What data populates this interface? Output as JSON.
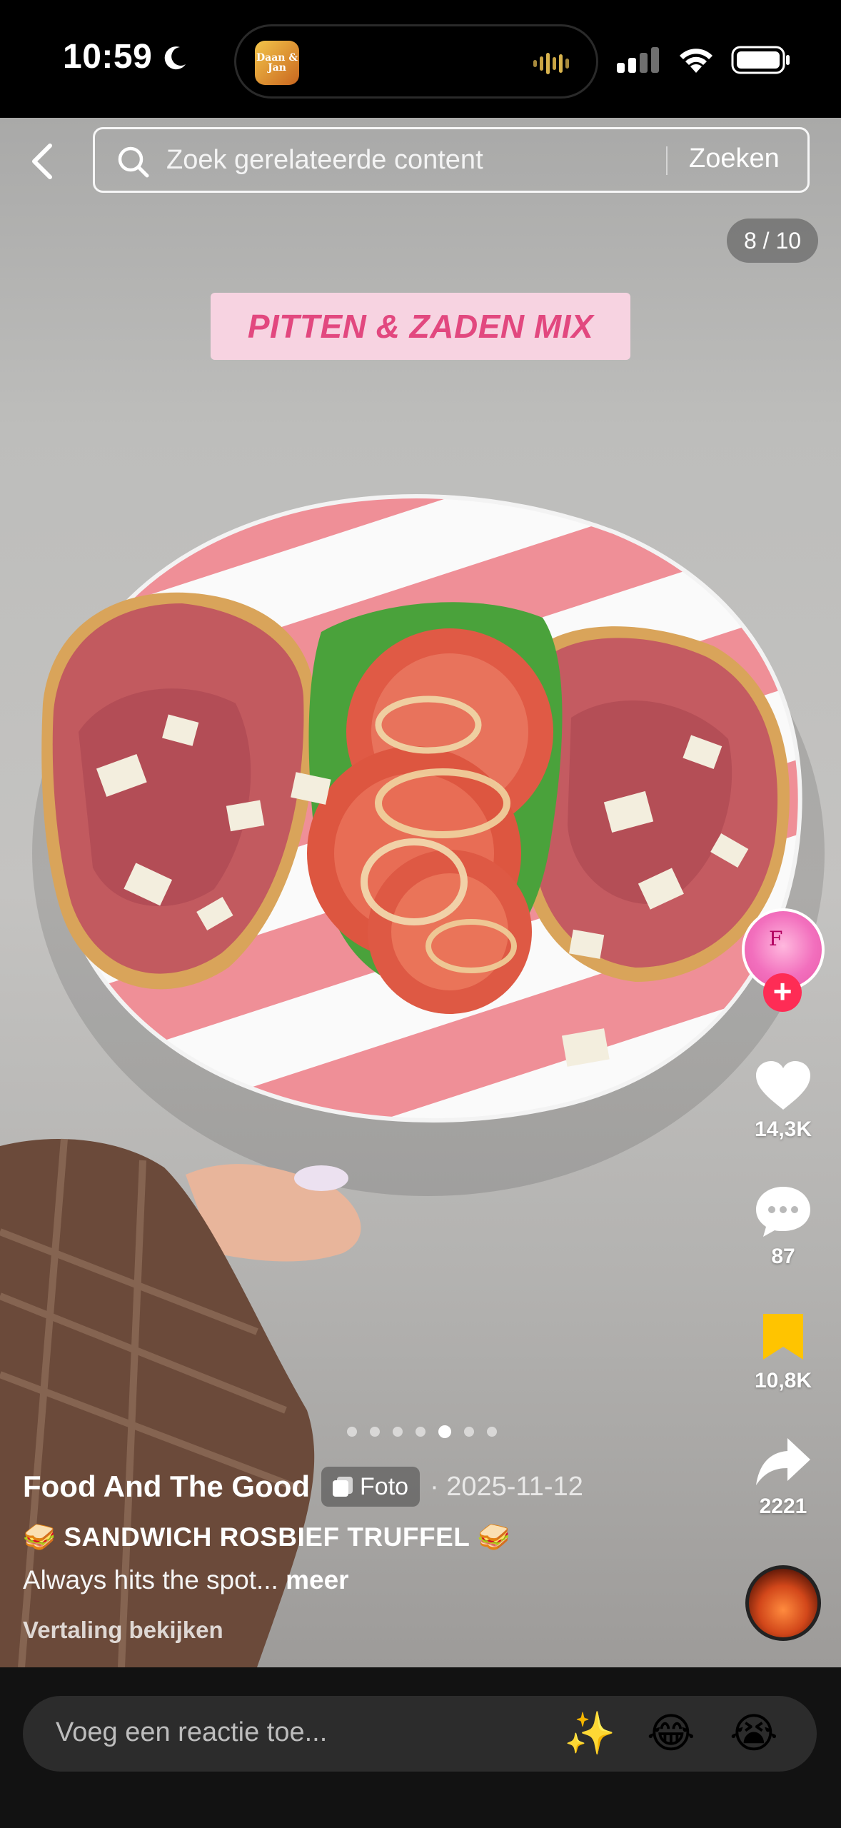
{
  "status_bar": {
    "time": "10:59",
    "island_app_badge": "Daan & Jan"
  },
  "search": {
    "placeholder": "Zoek gerelateerde content",
    "button_label": "Zoeken"
  },
  "carousel": {
    "counter": "8 / 10",
    "dot_count": 7,
    "active_dot": 4
  },
  "overlay_text": "PITTEN & ZADEN MIX",
  "actions": {
    "likes": "14,3K",
    "comments": "87",
    "saves": "10,8K",
    "shares": "2221",
    "follow_symbol": "+"
  },
  "post": {
    "author": "Food And The Good",
    "type_label": "Foto",
    "date": "· 2025-11-12",
    "title": "🥪 SANDWICH ROSBIEF TRUFFEL 🥪",
    "caption": "Always hits the spot...",
    "more_label": "meer",
    "translate_label": "Vertaling bekijken"
  },
  "comment_bar": {
    "placeholder": "Voeg een reactie toe...",
    "emojis": [
      "✨",
      "😂",
      "😭"
    ]
  },
  "colors": {
    "overlay_bg": "#f7d3e1",
    "overlay_text": "#e2487f",
    "follow": "#fe2c55",
    "bookmark_active": "#ffc400"
  }
}
